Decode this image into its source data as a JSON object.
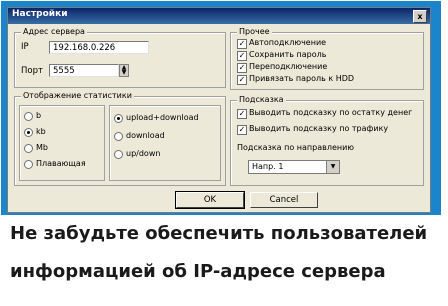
{
  "window": {
    "title": "Настройки",
    "close_label": "x"
  },
  "server_group": {
    "legend": "Адрес сервера",
    "ip_label": "IP",
    "ip_value": "192.168.0.226",
    "port_label": "Порт",
    "port_value": "5555"
  },
  "stats_group": {
    "legend": "Отображение статистики",
    "units": [
      "b",
      "kb",
      "Mb",
      "Плавающая"
    ],
    "units_selected": "kb",
    "direction": [
      "upload+download",
      "download",
      "up/down"
    ],
    "direction_selected": "upload+download"
  },
  "other_group": {
    "legend": "Прочее",
    "options": [
      {
        "label": "Автоподключение",
        "checked": true
      },
      {
        "label": "Сохранить пароль",
        "checked": true
      },
      {
        "label": "Переподключение",
        "checked": true
      },
      {
        "label": "Привязать пароль к HDD",
        "checked": true
      }
    ]
  },
  "hint_group": {
    "legend": "Подсказка",
    "options": [
      {
        "label": "Выводить подсказку по остатку денег",
        "checked": true
      },
      {
        "label": "Выводить подсказку по трафику",
        "checked": true
      }
    ],
    "direction_label": "Подсказка по направлению",
    "direction_value": "Напр. 1"
  },
  "buttons": {
    "ok": "OK",
    "cancel": "Cancel"
  },
  "caption": {
    "line1": "Не забудьте обеспечить пользователей",
    "line2": "информацией об IP-адресе сервера"
  },
  "colors": {
    "frame": "#1a85cb",
    "dialog": "#ece9d8"
  }
}
